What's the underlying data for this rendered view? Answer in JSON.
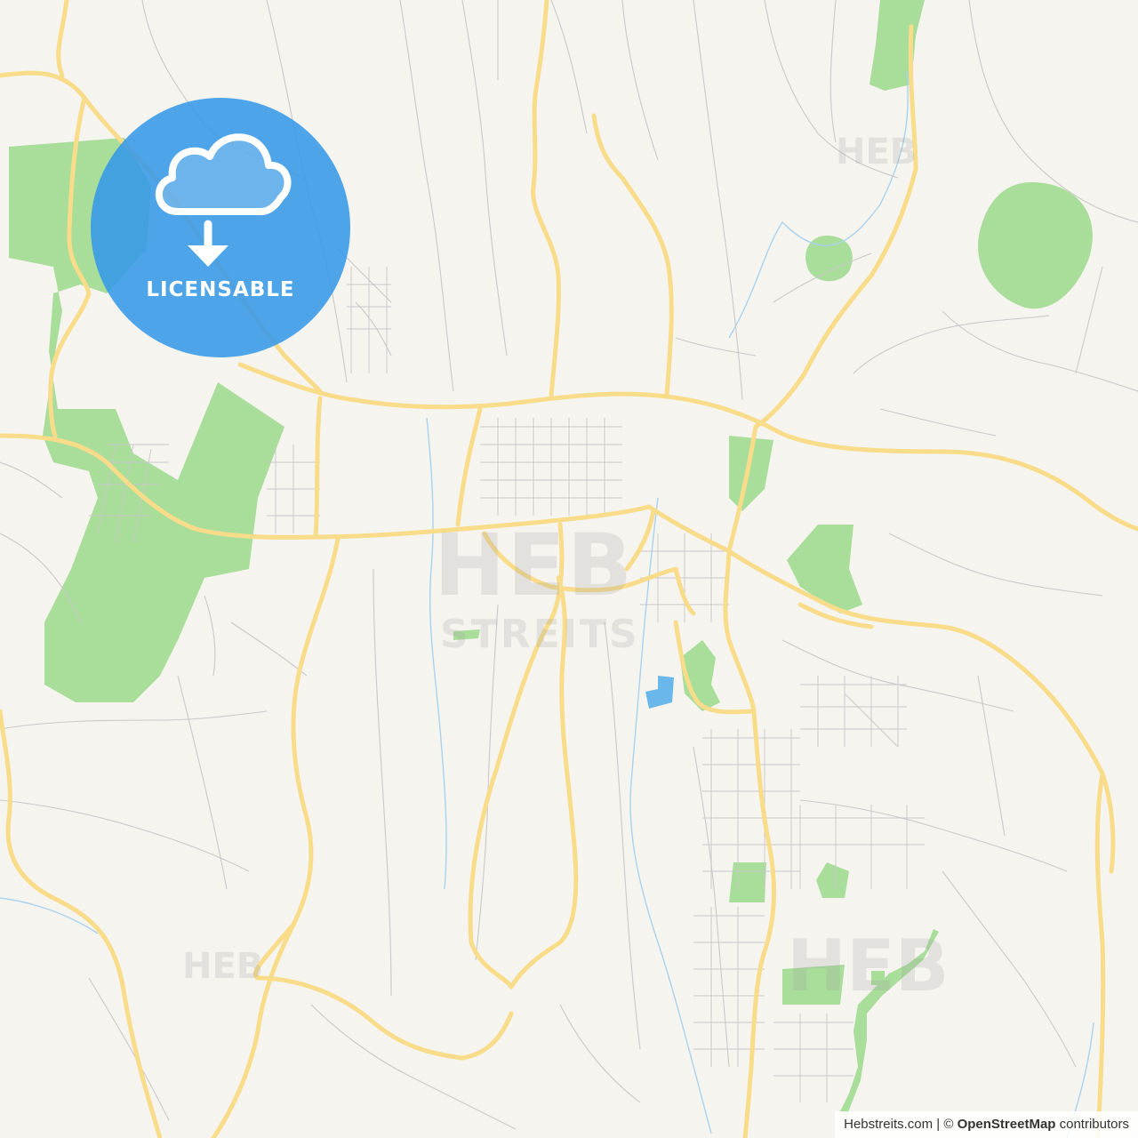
{
  "badge": {
    "label": "LICENSABLE",
    "icon": "cloud-download-icon",
    "color": "#3699e8"
  },
  "watermark": {
    "main": "HEB",
    "sub": "STREITS",
    "small": "HEB"
  },
  "attribution": {
    "site": "Hebstreits.com",
    "separator": " | © ",
    "osm": "OpenStreetMap",
    "suffix": " contributors"
  },
  "colors": {
    "land": "#f6f4ef",
    "park": "#a8dd9a",
    "major_road": "#f8dc8a",
    "minor_road": "#c9c9c9",
    "water": "#6ab7ec",
    "stream": "#a9d2ee"
  }
}
